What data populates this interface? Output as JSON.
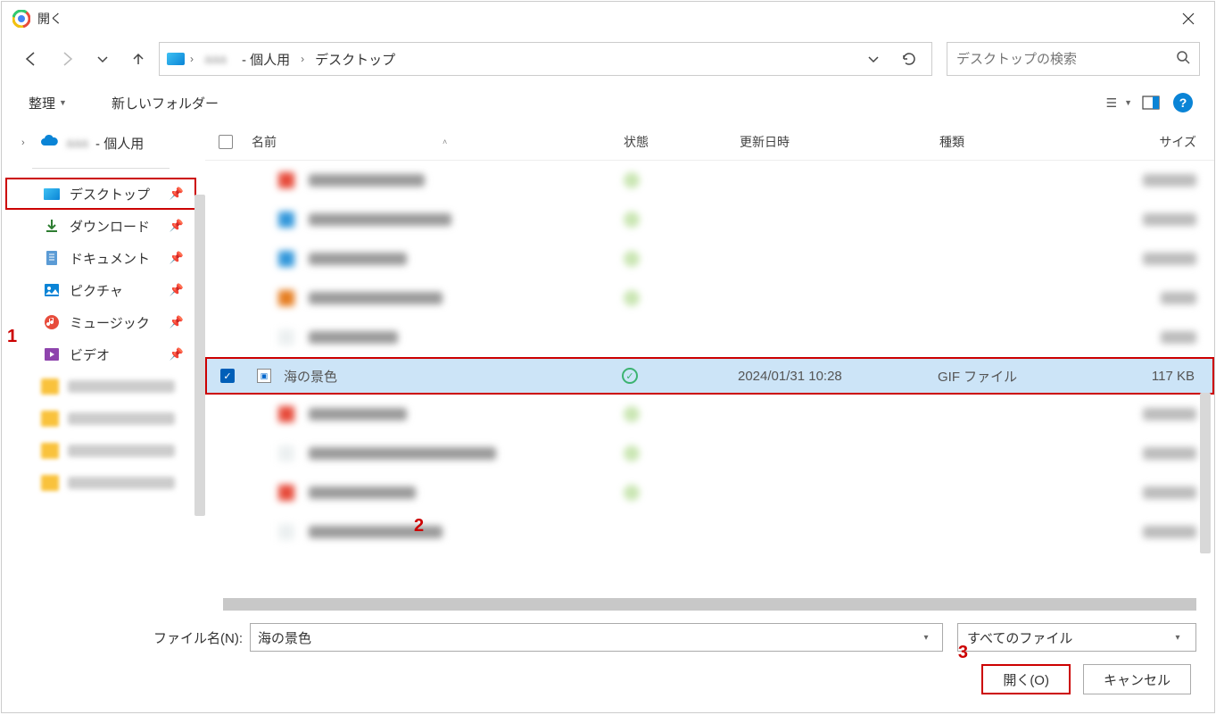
{
  "window": {
    "title": "開く"
  },
  "nav": {
    "breadcrumb": {
      "user_suffix": "- 個人用",
      "location": "デスクトップ"
    }
  },
  "search": {
    "placeholder": "デスクトップの検索"
  },
  "toolbar": {
    "organize": "整理",
    "new_folder": "新しいフォルダー"
  },
  "tree": {
    "onedrive_suffix": "- 個人用"
  },
  "quick_access": {
    "desktop": "デスクトップ",
    "downloads": "ダウンロード",
    "documents": "ドキュメント",
    "pictures": "ピクチャ",
    "music": "ミュージック",
    "videos": "ビデオ"
  },
  "columns": {
    "name": "名前",
    "status": "状態",
    "modified": "更新日時",
    "type": "種類",
    "size": "サイズ"
  },
  "selected_file": {
    "name": "海の景色",
    "modified": "2024/01/31 10:28",
    "type": "GIF ファイル",
    "size": "117 KB"
  },
  "footer": {
    "file_name_label": "ファイル名(N):",
    "file_name_value": "海の景色",
    "filter": "すべてのファイル",
    "open": "開く(O)",
    "cancel": "キャンセル"
  },
  "annotations": {
    "a1": "1",
    "a2": "2",
    "a3": "3"
  }
}
